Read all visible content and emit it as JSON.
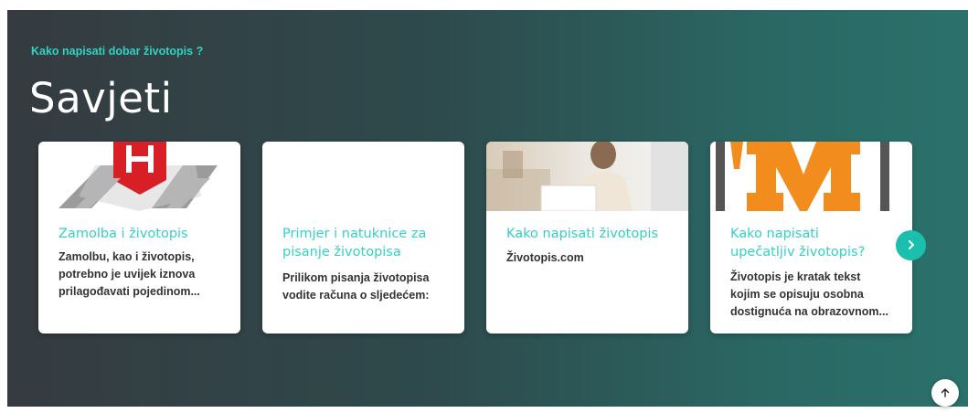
{
  "header": {
    "subtitle": "Kako napisati dobar životopis ?",
    "title": "Savjeti"
  },
  "cards": [
    {
      "title_lines": [
        "Zamolba i životopis"
      ],
      "text_lines": [
        "Zamolbu, kao i životopis,",
        "potrebno je uvijek iznova",
        "prilagođavati pojedinom..."
      ]
    },
    {
      "title_lines": [
        "Primjer i natuknice za",
        "pisanje životopisa"
      ],
      "text_lines": [
        "Prilikom pisanja životopisa",
        "vodite računa o sljedećem:"
      ]
    },
    {
      "title_lines": [
        "Kako napisati životopis"
      ],
      "text_lines": [
        "Životopis.com"
      ]
    },
    {
      "title_lines": [
        "Kako napisati",
        "upečatljiv životopis?"
      ],
      "text_lines": [
        "Životopis je kratak tekst",
        "kojim se opisuju osobna",
        "dostignuća na obrazovnom..."
      ]
    }
  ],
  "icons": {
    "next": "chevron-right-icon",
    "top": "arrow-up-icon"
  },
  "colors": {
    "accent": "#2fd3c0",
    "card_title": "#35d0c6",
    "button": "#1bbfae"
  }
}
